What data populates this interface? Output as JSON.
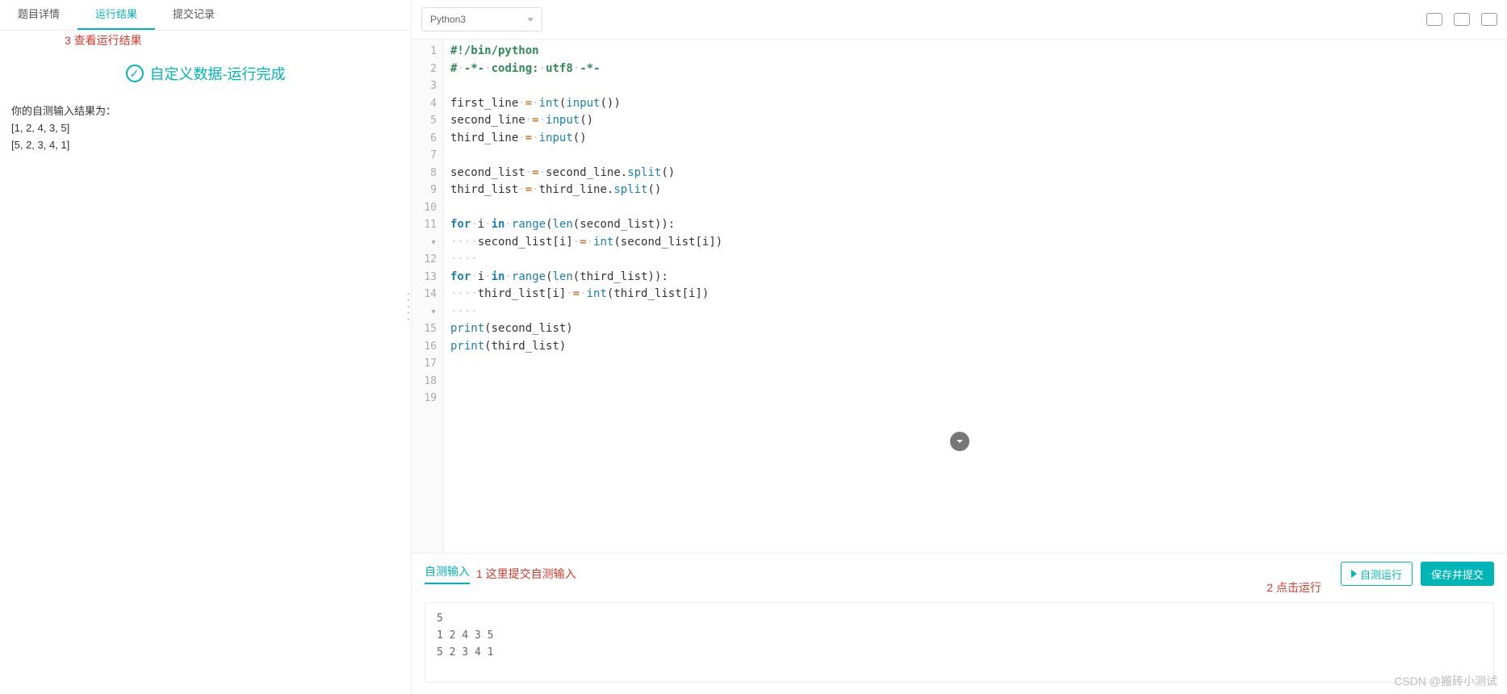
{
  "left": {
    "tabs": [
      "题目详情",
      "运行结果",
      "提交记录"
    ],
    "activeTab": 1,
    "annot3": "3 查看运行结果",
    "statusText": "自定义数据-运行完成",
    "resultLabel": "你的自测输入结果为：",
    "resultLines": [
      "[1, 2, 4, 3, 5]",
      "[5, 2, 3, 4, 1]"
    ]
  },
  "toolbar": {
    "language": "Python3"
  },
  "code": {
    "lines": [
      {
        "n": 1,
        "html": "<span class='gr'>#!/bin/python</span>"
      },
      {
        "n": 2,
        "html": "<span class='gr'>#</span><span class='dot'>·</span><span class='gr'>-*-</span><span class='dot'>·</span><span class='gr'>coding:</span><span class='dot'>·</span><span class='gr'>utf8</span><span class='dot'>·</span><span class='gr'>-*-</span>"
      },
      {
        "n": 3,
        "html": ""
      },
      {
        "n": 4,
        "html": "first_line<span class='dot'>·</span><span class='op'>=</span><span class='dot'>·</span><span class='fn'>int</span>(<span class='fn'>input</span>())"
      },
      {
        "n": 5,
        "html": "second_line<span class='dot'>·</span><span class='op'>=</span><span class='dot'>·</span><span class='fn'>input</span>()"
      },
      {
        "n": 6,
        "html": "third_line<span class='dot'>·</span><span class='op'>=</span><span class='dot'>·</span><span class='fn'>input</span>()"
      },
      {
        "n": 7,
        "html": ""
      },
      {
        "n": 8,
        "html": "second_list<span class='dot'>·</span><span class='op'>=</span><span class='dot'>·</span>second_line.<span class='fn'>split</span>()"
      },
      {
        "n": 9,
        "html": "third_list<span class='dot'>·</span><span class='op'>=</span><span class='dot'>·</span>third_line.<span class='fn'>split</span>()"
      },
      {
        "n": 10,
        "html": ""
      },
      {
        "n": 11,
        "fold": true,
        "html": "<span class='kw'>for</span><span class='dot'>·</span>i<span class='dot'>·</span><span class='kw'>in</span><span class='dot'>·</span><span class='fn'>range</span>(<span class='fn'>len</span>(second_list)):"
      },
      {
        "n": 12,
        "html": "<span class='dot'>····</span>second_list[i]<span class='dot'>·</span><span class='op'>=</span><span class='dot'>·</span><span class='fn'>int</span>(second_list[i])"
      },
      {
        "n": 13,
        "html": "<span class='dot'>····</span>"
      },
      {
        "n": 14,
        "fold": true,
        "html": "<span class='kw'>for</span><span class='dot'>·</span>i<span class='dot'>·</span><span class='kw'>in</span><span class='dot'>·</span><span class='fn'>range</span>(<span class='fn'>len</span>(third_list)):"
      },
      {
        "n": 15,
        "html": "<span class='dot'>····</span>third_list[i]<span class='dot'>·</span><span class='op'>=</span><span class='dot'>·</span><span class='fn'>int</span>(third_list[i])"
      },
      {
        "n": 16,
        "html": "<span class='dot'>····</span>"
      },
      {
        "n": 17,
        "html": "<span class='fn'>print</span>(second_list)"
      },
      {
        "n": 18,
        "html": "<span class='fn'>print</span>(third_list)"
      },
      {
        "n": 19,
        "html": ""
      }
    ]
  },
  "bottom": {
    "tabLabel": "自测输入",
    "annot1": "1 这里提交自测输入",
    "annot2": "2 点击运行",
    "runLabel": "自测运行",
    "submitLabel": "保存并提交",
    "testInput": "5\n1 2 4 3 5\n5 2 3 4 1"
  },
  "watermark": "CSDN @搬砖小测试"
}
